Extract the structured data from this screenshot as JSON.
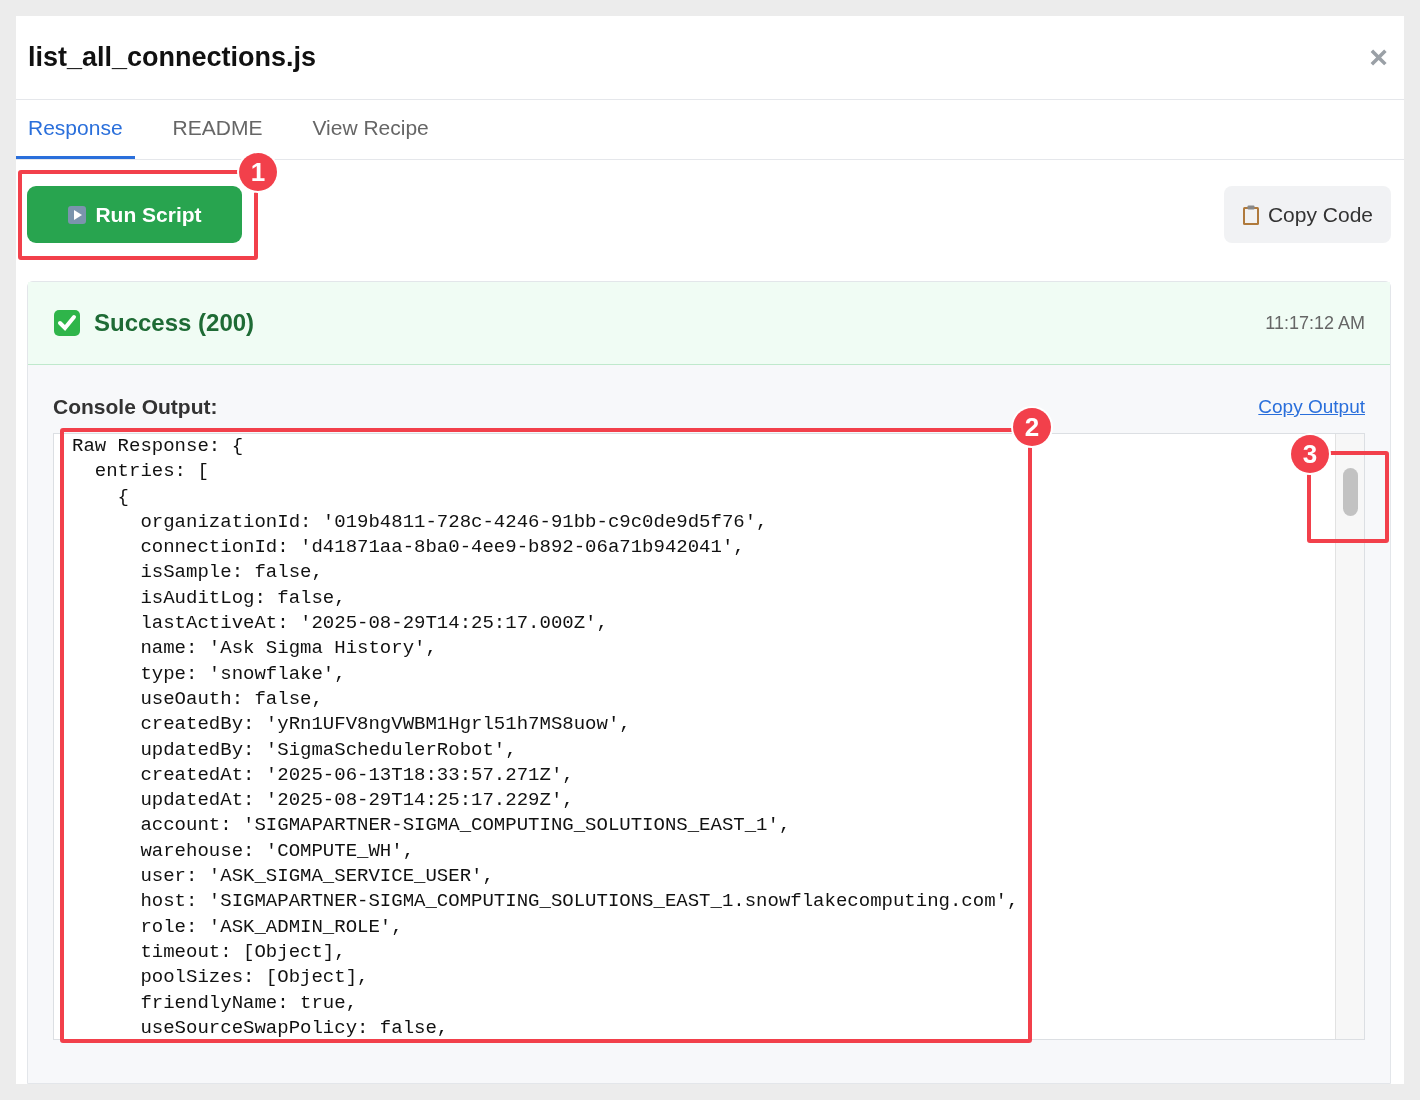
{
  "dialog": {
    "title": "list_all_connections.js",
    "close": "×"
  },
  "tabs": [
    {
      "label": "Response",
      "selected": true
    },
    {
      "label": "README",
      "selected": false
    },
    {
      "label": "View Recipe",
      "selected": false
    }
  ],
  "toolbar": {
    "run_button": "Run Script",
    "copy_button": "Copy Code"
  },
  "result": {
    "status": "Success (200)",
    "time": "11:17:12 AM",
    "console_label": "Console Output:",
    "copy_output": "Copy Output",
    "lines": [
      "Raw Response: {",
      "  entries: [",
      "    {",
      "      organizationId: '019b4811-728c-4246-91bb-c9c0de9d5f76',",
      "      connectionId: 'd41871aa-8ba0-4ee9-b892-06a71b942041',",
      "      isSample: false,",
      "      isAuditLog: false,",
      "      lastActiveAt: '2025-08-29T14:25:17.000Z',",
      "      name: 'Ask Sigma History',",
      "      type: 'snowflake',",
      "      useOauth: false,",
      "      createdBy: 'yRn1UFV8ngVWBM1Hgrl51h7MS8uow',",
      "      updatedBy: 'SigmaSchedulerRobot',",
      "      createdAt: '2025-06-13T18:33:57.271Z',",
      "      updatedAt: '2025-08-29T14:25:17.229Z',",
      "      account: 'SIGMAPARTNER-SIGMA_COMPUTING_SOLUTIONS_EAST_1',",
      "      warehouse: 'COMPUTE_WH',",
      "      user: 'ASK_SIGMA_SERVICE_USER',",
      "      host: 'SIGMAPARTNER-SIGMA_COMPUTING_SOLUTIONS_EAST_1.snowflakecomputing.com',",
      "      role: 'ASK_ADMIN_ROLE',",
      "      timeout: [Object],",
      "      poolSizes: [Object],",
      "      friendlyName: true,",
      "      useSourceSwapPolicy: false,"
    ]
  },
  "annotations": [
    {
      "label": "1"
    },
    {
      "label": "2"
    },
    {
      "label": "3"
    }
  ]
}
